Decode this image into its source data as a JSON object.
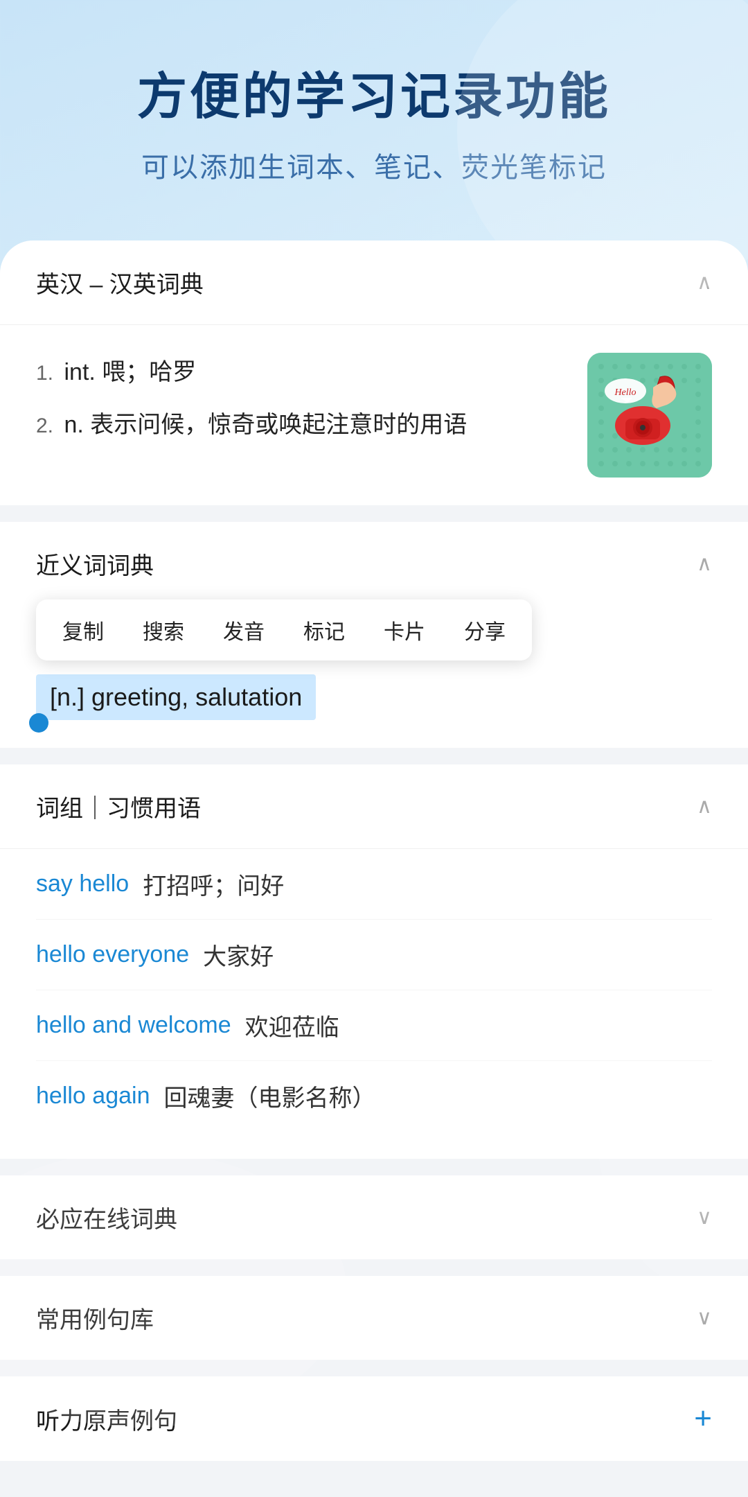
{
  "header": {
    "title": "方便的学习记录功能",
    "subtitle": "可以添加生词本、笔记、荧光笔标记"
  },
  "sections": {
    "dict_header": "英汉 – 汉英词典",
    "definitions": [
      {
        "num": "1.",
        "type": "int.",
        "text": "喂；哈罗"
      },
      {
        "num": "2.",
        "type": "n.",
        "text": "表示问候，惊奇或唤起注意时的用语"
      }
    ],
    "synonyms_header": "近义词词典",
    "context_menu": [
      "复制",
      "搜索",
      "发音",
      "标记",
      "卡片",
      "分享"
    ],
    "selected_text": "[n.] greeting, salutation",
    "phrases_header": "词组｜习惯用语",
    "phrases": [
      {
        "english": "say hello",
        "chinese": "打招呼；问好"
      },
      {
        "english": "hello everyone",
        "chinese": "大家好"
      },
      {
        "english": "hello and welcome",
        "chinese": "欢迎莅临"
      },
      {
        "english": "hello again",
        "chinese": "回魂妻（电影名称）"
      }
    ],
    "biyingzaixian": "必应在线词典",
    "changyongliju": "常用例句库",
    "tingli": "听力原声例句"
  }
}
